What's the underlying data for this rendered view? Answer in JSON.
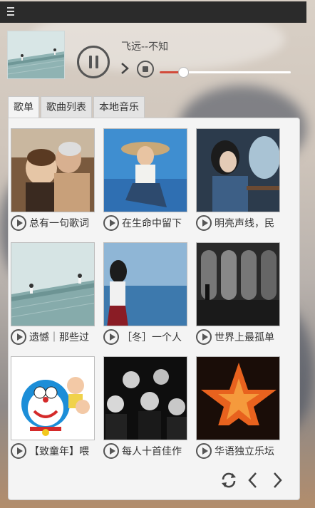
{
  "window": {
    "menu_icon": "hamburger-icon"
  },
  "player": {
    "title": "飞远--不知",
    "icons": {
      "play_pause": "pause-icon",
      "next": "next-icon",
      "stop": "stop-icon"
    },
    "progress": 0.18,
    "progress_color": "#d24a3a"
  },
  "tabs": [
    {
      "label": "歌单",
      "active": true
    },
    {
      "label": "歌曲列表",
      "active": false
    },
    {
      "label": "本地音乐",
      "active": false
    }
  ],
  "playlists": [
    {
      "title": "总有一句歌词",
      "cover": "couple-embrace"
    },
    {
      "title": "在生命中留下",
      "cover": "girl-hat-sky"
    },
    {
      "title": "明亮声线，民",
      "cover": "girl-window"
    },
    {
      "title": "遗憾｜那些过",
      "cover": "figures-on-ramp"
    },
    {
      "title": "［冬］一个人",
      "cover": "girl-sea-view"
    },
    {
      "title": "世界上最孤单",
      "cover": "arches-silhouette"
    },
    {
      "title": "【致童年】喂",
      "cover": "doraemon"
    },
    {
      "title": "每人十首佳作",
      "cover": "band-bw"
    },
    {
      "title": "华语独立乐坛",
      "cover": "orange-star"
    }
  ],
  "pager": {
    "refresh_icon": "refresh-icon",
    "prev_icon": "chevron-left-icon",
    "next_icon": "chevron-right-icon"
  }
}
